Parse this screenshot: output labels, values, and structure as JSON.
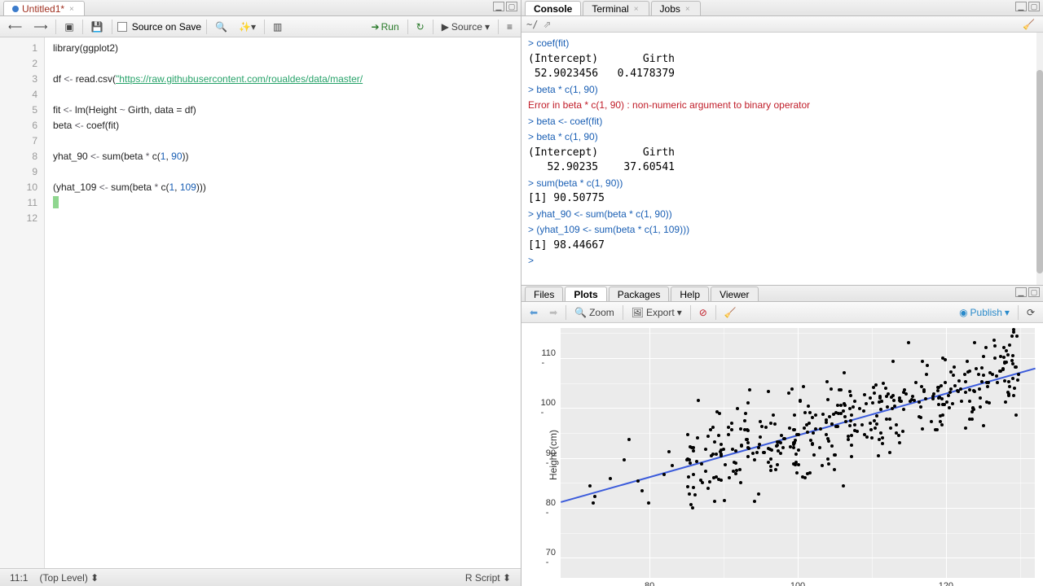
{
  "editor": {
    "tab_title": "Untitled1*",
    "source_on_save": "Source on Save",
    "run": "Run",
    "source_btn": "Source",
    "lines": [
      "library(ggplot2)",
      "",
      "df <- read.csv(\"https://raw.githubusercontent.com/roualdes/data/master/",
      "",
      "fit <- lm(Height ~ Girth, data = df)",
      "beta <- coef(fit)",
      "",
      "yhat_90 <- sum(beta * c(1, 90))",
      "",
      "(yhat_109 <- sum(beta * c(1, 109)))",
      "",
      ""
    ],
    "cursor_pos": "11:1",
    "scope": "(Top Level)",
    "lang": "R Script"
  },
  "console": {
    "tabs": [
      "Console",
      "Terminal",
      "Jobs"
    ],
    "cwd": "~/",
    "lines": [
      {
        "t": "prompt",
        "v": "> coef(fit)"
      },
      {
        "t": "out",
        "v": "(Intercept)       Girth "
      },
      {
        "t": "out",
        "v": " 52.9023456   0.4178379 "
      },
      {
        "t": "prompt",
        "v": "> beta * c(1, 90)"
      },
      {
        "t": "err",
        "v": "Error in beta * c(1, 90) : non-numeric argument to binary operator"
      },
      {
        "t": "prompt",
        "v": "> beta <- coef(fit)"
      },
      {
        "t": "prompt",
        "v": "> beta * c(1, 90)"
      },
      {
        "t": "out",
        "v": "(Intercept)       Girth "
      },
      {
        "t": "out",
        "v": "   52.90235    37.60541 "
      },
      {
        "t": "prompt",
        "v": "> sum(beta * c(1, 90))"
      },
      {
        "t": "out",
        "v": "[1] 90.50775"
      },
      {
        "t": "prompt",
        "v": "> yhat_90 <- sum(beta * c(1, 90))"
      },
      {
        "t": "prompt",
        "v": "> (yhat_109 <- sum(beta * c(1, 109)))"
      },
      {
        "t": "out",
        "v": "[1] 98.44667"
      },
      {
        "t": "prompt",
        "v": "> "
      }
    ]
  },
  "br": {
    "tabs": [
      "Files",
      "Plots",
      "Packages",
      "Help",
      "Viewer"
    ],
    "active_tab": "Plots",
    "zoom": "Zoom",
    "export": "Export",
    "publish": "Publish"
  },
  "chart_data": {
    "type": "scatter",
    "xlabel": "",
    "ylabel": "Height (cm)",
    "xticks": [
      80,
      100,
      120
    ],
    "yticks": [
      70,
      80,
      90,
      100,
      110
    ],
    "xlim": [
      68,
      132
    ],
    "ylim": [
      66,
      116
    ],
    "fit_line": {
      "slope": 0.4178379,
      "intercept": 52.9023456,
      "color": "#3b5bdb"
    },
    "n_points": 420,
    "point_cloud_hint": "dense jittered scatter roughly along fit line with sd ~5 in y, girth mostly 85-130"
  }
}
